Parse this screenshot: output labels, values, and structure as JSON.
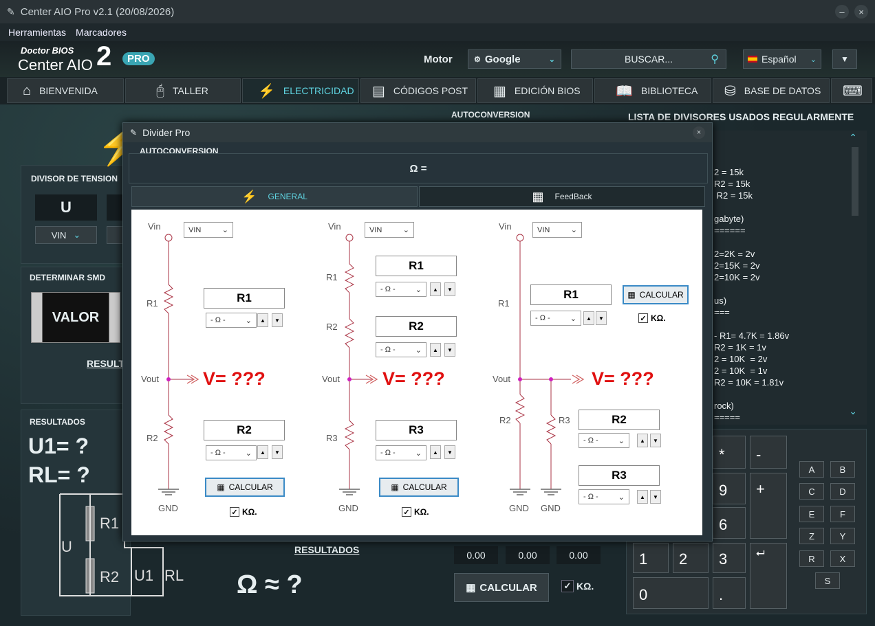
{
  "app": {
    "title": "Center AIO Pro v2.1 (20/08/2026)",
    "logo_top": "Doctor BIOS",
    "logo_main": "Center AIO",
    "logo_num": "2",
    "logo_pro": "PRO"
  },
  "menu": [
    "Herramientas",
    "Marcadores"
  ],
  "header": {
    "motor_label": "Motor",
    "engine": "Google",
    "search_placeholder": "BUSCAR...",
    "language": "Español"
  },
  "tabs": [
    {
      "label": "BIENVENIDA"
    },
    {
      "label": "TALLER"
    },
    {
      "label": "ELECTRICIDAD"
    },
    {
      "label": "CÓDIGOS POST"
    },
    {
      "label": "EDICIÓN BIOS"
    },
    {
      "label": "BIBLIOTECA"
    },
    {
      "label": "BASE DE DATOS"
    }
  ],
  "left": {
    "divisor_title": "DIVISOR DE TENSION",
    "u_label": "U",
    "vin_select": "VIN",
    "smd_title": "DETERMINAR SMD",
    "smd_value": "VALOR",
    "result_link": "RESULT",
    "resultados_title": "RESULTADOS",
    "u1": "U1= ?",
    "rl": "RL= ?",
    "diag_r1": "R1",
    "diag_r2": "R2",
    "diag_u": "U",
    "diag_u1": "U1",
    "diag_rl": "RL"
  },
  "background": {
    "autoconv": "AUTOCONVERSION",
    "resultados_link": "RESULTADOS",
    "ohm_approx": "Ω ≈ ?",
    "values": [
      "0.00",
      "0.00",
      "0.00"
    ],
    "calcular": "CALCULAR",
    "kohm": "KΩ."
  },
  "list": {
    "title": "LISTA DE DIVISORES USADOS REGULARMENTE",
    "lines": [
      "2 = 15k",
      "R2 = 15k",
      " R2 = 15k",
      "",
      "gabyte)",
      "======",
      "",
      "2=2K = 2v",
      "2=15K = 2v",
      "2=10K = 2v",
      "",
      "us)",
      "===",
      "",
      "- R1= 4.7K = 1.86v",
      "R2 = 1K = 1v",
      "2 = 10K  = 2v",
      "2 = 10K  = 1v",
      "R2 = 10K = 1.81v",
      "",
      "rock)",
      "====="
    ]
  },
  "keypad": {
    "keys": [
      "*",
      "-",
      "9",
      "+",
      "6",
      "1",
      "2",
      "3",
      "0",
      "."
    ],
    "letters": [
      "A",
      "B",
      "C",
      "D",
      "E",
      "F",
      "Z",
      "Y",
      "R",
      "X",
      "S"
    ]
  },
  "dialog": {
    "title": "Divider Pro",
    "autoconv": "AUTOCONVERSION",
    "ohm_eq": "Ω =",
    "tab_general": "GENERAL",
    "tab_feedback": "FeedBack",
    "vin": "Vin",
    "vin_select": "VIN",
    "vout": "Vout",
    "gnd": "GND",
    "v_result": "V= ???",
    "ohm_select": "- Ω -",
    "calcular": "CALCULAR",
    "kohm": "KΩ.",
    "r1": "R1",
    "r2": "R2",
    "r3": "R3"
  }
}
